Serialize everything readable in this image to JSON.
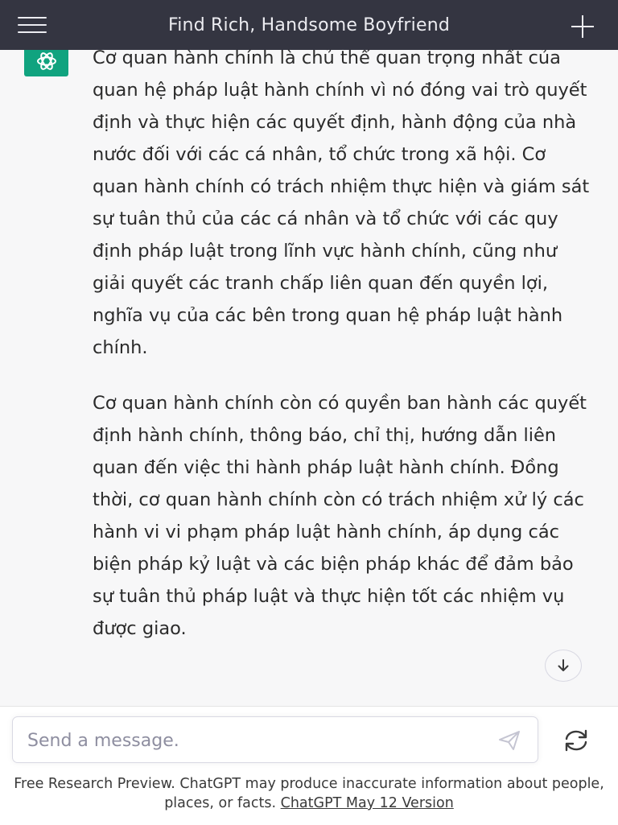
{
  "header": {
    "title": "Find Rich, Handsome Boyfriend",
    "menu_icon": "hamburger-menu-icon",
    "new_chat_icon": "plus-icon"
  },
  "conversation": {
    "assistant_avatar_icon": "openai-logo-icon",
    "paragraphs": [
      "Cơ quan hành chính là chủ thể quan trọng nhất của quan hệ pháp luật hành chính vì nó đóng vai trò quyết định và thực hiện các quyết định, hành động của nhà nước đối với các cá nhân, tổ chức trong xã hội. Cơ quan hành chính có trách nhiệm thực hiện và giám sát sự tuân thủ của các cá nhân và tổ chức với các quy định pháp luật trong lĩnh vực hành chính, cũng như giải quyết các tranh chấp liên quan đến quyền lợi, nghĩa vụ của các bên trong quan hệ pháp luật hành chính.",
      "Cơ quan hành chính còn có quyền ban hành các quyết định hành chính, thông báo, chỉ thị, hướng dẫn liên quan đến việc thi hành pháp luật hành chính. Đồng thời, cơ quan hành chính còn có trách nhiệm xử lý các hành vi vi phạm pháp luật hành chính, áp dụng các biện pháp kỷ luật và các biện pháp khác để đảm bảo sự tuân thủ pháp luật và thực hiện tốt các nhiệm vụ được giao."
    ],
    "scroll_down_icon": "arrow-down-icon"
  },
  "composer": {
    "placeholder": "Send a message.",
    "send_icon": "send-icon",
    "regenerate_icon": "refresh-icon"
  },
  "footer": {
    "text": "Free Research Preview. ChatGPT may produce inaccurate information about people, places, or facts.",
    "link_label": "ChatGPT May 12 Version"
  },
  "colors": {
    "header_bg": "#343541",
    "accent": "#10a37f",
    "page_bg": "#f7f7f8"
  }
}
